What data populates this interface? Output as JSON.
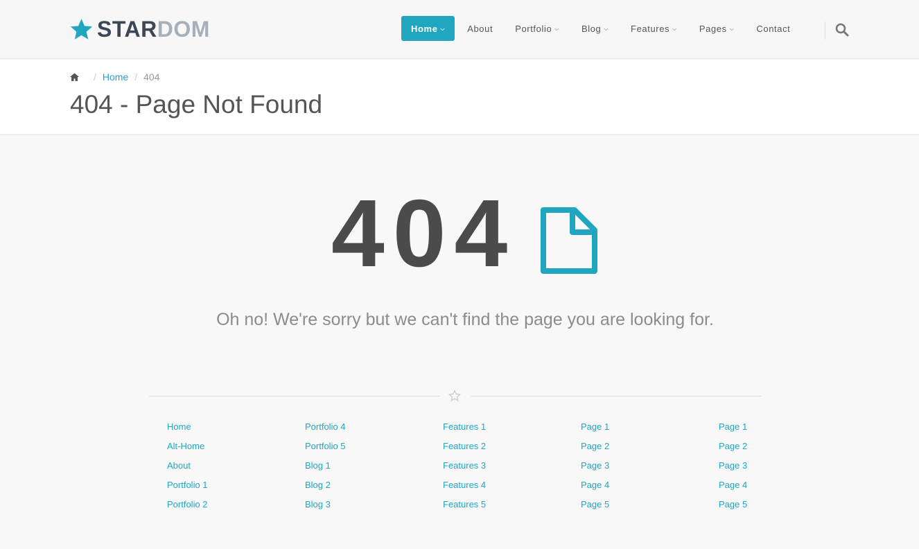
{
  "brand": {
    "part1": "STAR",
    "part2": "DOM"
  },
  "nav": [
    {
      "label": "Home",
      "dropdown": true,
      "active": true
    },
    {
      "label": "About",
      "dropdown": false
    },
    {
      "label": "Portfolio",
      "dropdown": true
    },
    {
      "label": "Blog",
      "dropdown": true
    },
    {
      "label": "Features",
      "dropdown": true
    },
    {
      "label": "Pages",
      "dropdown": true
    },
    {
      "label": "Contact",
      "dropdown": false
    }
  ],
  "breadcrumb": {
    "home": "Home",
    "current": "404"
  },
  "page_title": "404 - Page Not Found",
  "error": {
    "code": "404",
    "message": "Oh no! We're sorry but we can't find the page you are looking for."
  },
  "sitemap": [
    [
      "Home",
      "Alt-Home",
      "About",
      "Portfolio 1",
      "Portfolio 2"
    ],
    [
      "Portfolio 4",
      "Portfolio 5",
      "Blog 1",
      "Blog 2",
      "Blog 3"
    ],
    [
      "Features 1",
      "Features 2",
      "Features 3",
      "Features 4",
      "Features 5"
    ],
    [
      "Page 1",
      "Page 2",
      "Page 3",
      "Page 4",
      "Page 5"
    ],
    [
      "Page 1",
      "Page 2",
      "Page 3",
      "Page 4",
      "Page 5"
    ]
  ],
  "colors": {
    "accent": "#21a6c0",
    "logo_dark": "#3c4654",
    "logo_light": "#a6b0bb",
    "text": "#555555"
  },
  "icons": {
    "logo": "star-icon",
    "search": "search-icon",
    "home": "home-icon",
    "error": "file-icon",
    "divider": "star-outline-icon"
  }
}
